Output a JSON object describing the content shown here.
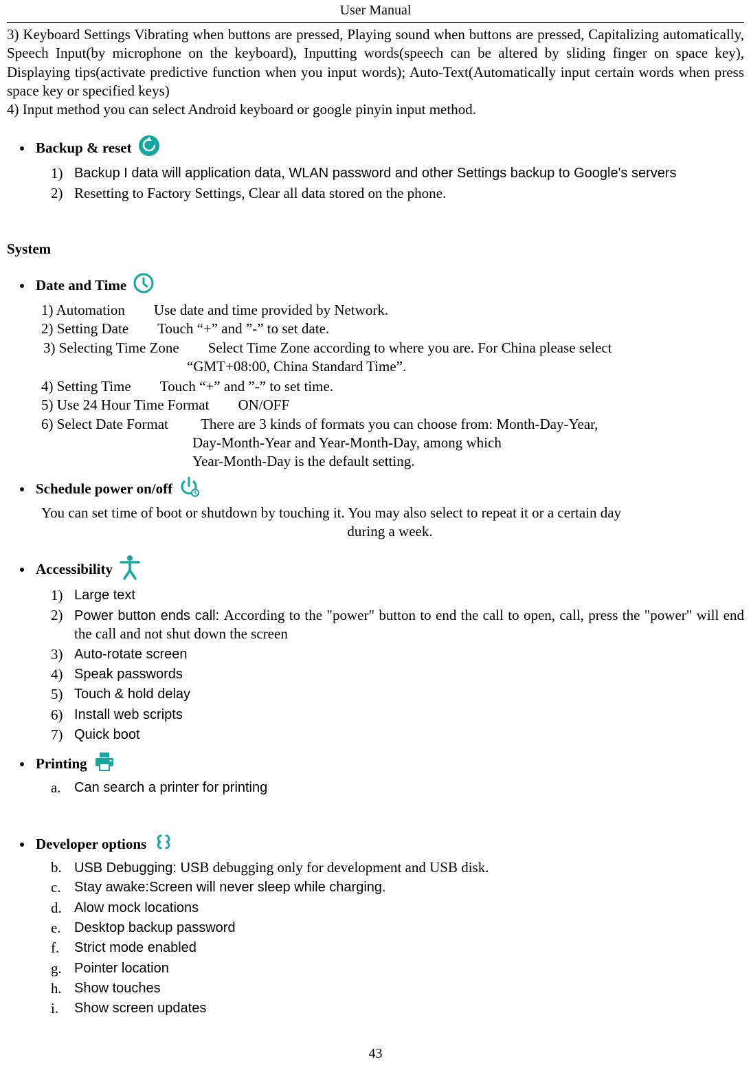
{
  "header": {
    "title": "User    Manual"
  },
  "page_number": "43",
  "intro": {
    "p1": "3) Keyboard Settings        Vibrating when buttons are pressed, Playing sound when buttons are pressed, Capitalizing automatically, Speech Input(by microphone on the keyboard), Inputting words(speech can be altered by sliding finger on space key), Displaying tips(activate predictive function when you input words); Auto-Text(Automatically input certain words when press space key or specified keys)",
    "p2": "4) Input method        you can select Android keyboard or google pinyin input method."
  },
  "backup": {
    "title": "Backup & reset",
    "items": [
      {
        "m": "1)",
        "t": "Backup I data will application data, WLAN password and other Settings backup to Google's servers",
        "sans": true
      },
      {
        "m": "2)",
        "t": "Resetting to Factory Settings, Clear all data stored on the phone."
      }
    ]
  },
  "system_heading": "System",
  "datetime": {
    "title": "Date and Time",
    "rows": [
      {
        "label": "1) Automation        ",
        "desc": "Use date and time provided by Network."
      },
      {
        "label": "2) Setting Date        ",
        "desc": "Touch “+” and ”-” to set date."
      }
    ],
    "row3_label": "    3) Selecting Time Zone        ",
    "row3_desc": "Select Time Zone according to where you are. For China please select",
    "row3_cont": "“GMT+08:00, China Standard Time”.",
    "rows_b": [
      {
        "label": "4) Setting Time        ",
        "desc": "Touch “+” and ”-” to set time."
      },
      {
        "label": "5) Use 24 Hour Time Format        ",
        "desc": "ON/OFF"
      }
    ],
    "row6_label": "6) Select Date Format         ",
    "row6_desc": "There are 3 kinds of formats you can choose from: Month-Day-Year,",
    "row6_cont1": "Day-Month-Year      and      Year-Month-Day,      among      which",
    "row6_cont2": "Year-Month-Day is the default setting."
  },
  "schedule": {
    "title": "Schedule power on/off",
    "desc1": "You can set time of boot or shutdown by touching it. You may also select to repeat it or a certain day",
    "desc2": "during a week."
  },
  "accessibility": {
    "title": "Accessibility",
    "items": [
      {
        "m": "1)",
        "t": "Large text",
        "sans": true
      },
      {
        "m": "2)",
        "t": "Power button ends call: According to the \"power\" button to end the call to open, call, press the \"power\" will end the call and not shut down the screen",
        "mixed": true
      },
      {
        "m": "3)",
        "t": "Auto-rotate screen",
        "sans": true
      },
      {
        "m": "4)",
        "t": "Speak passwords",
        "sans": true
      },
      {
        "m": "5)",
        "t": "Touch & hold delay",
        "sans": true
      },
      {
        "m": "6)",
        "t": "Install web scripts",
        "sans": true
      },
      {
        "m": "7)",
        "t": "Quick boot",
        "sans": true
      }
    ]
  },
  "printing": {
    "title": "Printing",
    "items": [
      {
        "m": "a.",
        "t": "Can search a printer for printing",
        "sans": true
      }
    ]
  },
  "developer": {
    "title": "Developer    options",
    "items": [
      {
        "m": "b.",
        "t_lead": "USB Debugging: US",
        "t_rest": "B debugging only for development and USB disk."
      },
      {
        "m": "c.",
        "t": "Stay awake:Screen will never sleep while charging.",
        "sans": true
      },
      {
        "m": "d.",
        "t": "Alow mock locations",
        "sans": true
      },
      {
        "m": "e.",
        "t": "Desktop backup password",
        "sans": true
      },
      {
        "m": "f.",
        "t": "Strict mode enabled",
        "sans": true
      },
      {
        "m": "g.",
        "t": "Pointer location",
        "sans": true
      },
      {
        "m": "h.",
        "t": "Show touches",
        "sans": true
      },
      {
        "m": "i.",
        "t": "Show screen updates",
        "sans": true
      }
    ]
  }
}
